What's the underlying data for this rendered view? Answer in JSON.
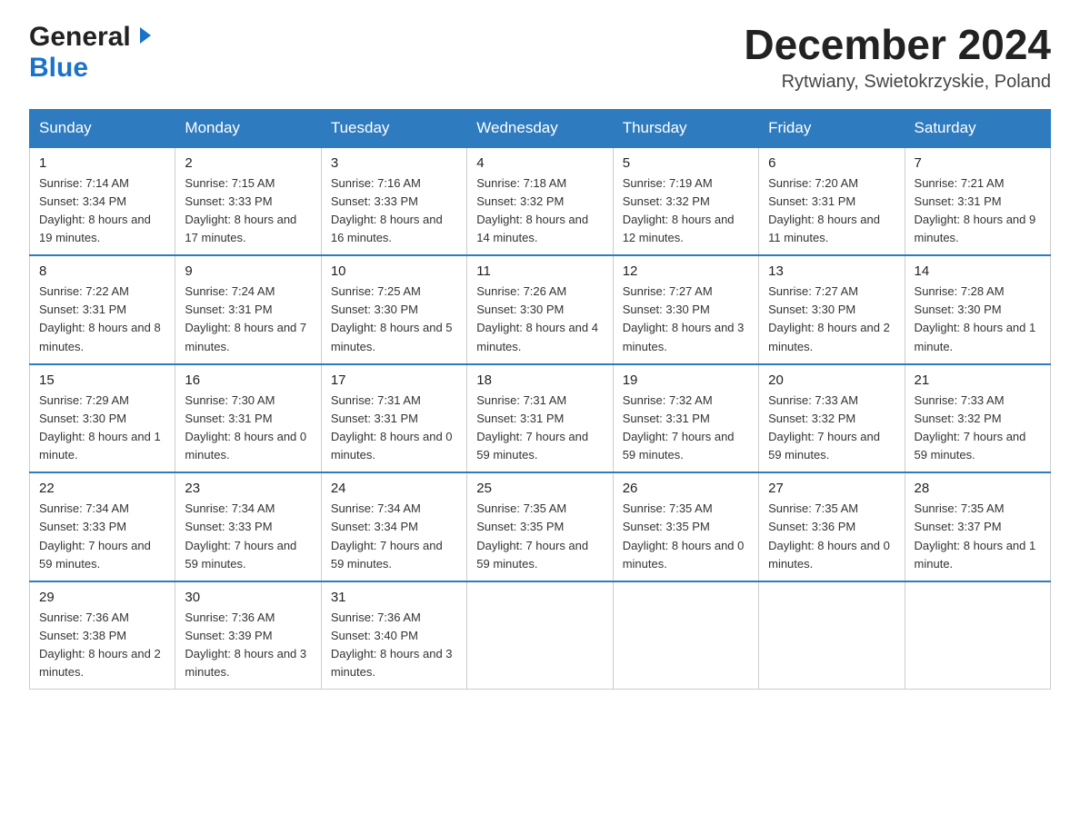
{
  "header": {
    "logo_general": "General",
    "logo_blue": "Blue",
    "month_title": "December 2024",
    "location": "Rytwiany, Swietokrzyskie, Poland"
  },
  "days_of_week": [
    "Sunday",
    "Monday",
    "Tuesday",
    "Wednesday",
    "Thursday",
    "Friday",
    "Saturday"
  ],
  "weeks": [
    [
      {
        "day": "1",
        "sunrise": "7:14 AM",
        "sunset": "3:34 PM",
        "daylight": "8 hours and 19 minutes."
      },
      {
        "day": "2",
        "sunrise": "7:15 AM",
        "sunset": "3:33 PM",
        "daylight": "8 hours and 17 minutes."
      },
      {
        "day": "3",
        "sunrise": "7:16 AM",
        "sunset": "3:33 PM",
        "daylight": "8 hours and 16 minutes."
      },
      {
        "day": "4",
        "sunrise": "7:18 AM",
        "sunset": "3:32 PM",
        "daylight": "8 hours and 14 minutes."
      },
      {
        "day": "5",
        "sunrise": "7:19 AM",
        "sunset": "3:32 PM",
        "daylight": "8 hours and 12 minutes."
      },
      {
        "day": "6",
        "sunrise": "7:20 AM",
        "sunset": "3:31 PM",
        "daylight": "8 hours and 11 minutes."
      },
      {
        "day": "7",
        "sunrise": "7:21 AM",
        "sunset": "3:31 PM",
        "daylight": "8 hours and 9 minutes."
      }
    ],
    [
      {
        "day": "8",
        "sunrise": "7:22 AM",
        "sunset": "3:31 PM",
        "daylight": "8 hours and 8 minutes."
      },
      {
        "day": "9",
        "sunrise": "7:24 AM",
        "sunset": "3:31 PM",
        "daylight": "8 hours and 7 minutes."
      },
      {
        "day": "10",
        "sunrise": "7:25 AM",
        "sunset": "3:30 PM",
        "daylight": "8 hours and 5 minutes."
      },
      {
        "day": "11",
        "sunrise": "7:26 AM",
        "sunset": "3:30 PM",
        "daylight": "8 hours and 4 minutes."
      },
      {
        "day": "12",
        "sunrise": "7:27 AM",
        "sunset": "3:30 PM",
        "daylight": "8 hours and 3 minutes."
      },
      {
        "day": "13",
        "sunrise": "7:27 AM",
        "sunset": "3:30 PM",
        "daylight": "8 hours and 2 minutes."
      },
      {
        "day": "14",
        "sunrise": "7:28 AM",
        "sunset": "3:30 PM",
        "daylight": "8 hours and 1 minute."
      }
    ],
    [
      {
        "day": "15",
        "sunrise": "7:29 AM",
        "sunset": "3:30 PM",
        "daylight": "8 hours and 1 minute."
      },
      {
        "day": "16",
        "sunrise": "7:30 AM",
        "sunset": "3:31 PM",
        "daylight": "8 hours and 0 minutes."
      },
      {
        "day": "17",
        "sunrise": "7:31 AM",
        "sunset": "3:31 PM",
        "daylight": "8 hours and 0 minutes."
      },
      {
        "day": "18",
        "sunrise": "7:31 AM",
        "sunset": "3:31 PM",
        "daylight": "7 hours and 59 minutes."
      },
      {
        "day": "19",
        "sunrise": "7:32 AM",
        "sunset": "3:31 PM",
        "daylight": "7 hours and 59 minutes."
      },
      {
        "day": "20",
        "sunrise": "7:33 AM",
        "sunset": "3:32 PM",
        "daylight": "7 hours and 59 minutes."
      },
      {
        "day": "21",
        "sunrise": "7:33 AM",
        "sunset": "3:32 PM",
        "daylight": "7 hours and 59 minutes."
      }
    ],
    [
      {
        "day": "22",
        "sunrise": "7:34 AM",
        "sunset": "3:33 PM",
        "daylight": "7 hours and 59 minutes."
      },
      {
        "day": "23",
        "sunrise": "7:34 AM",
        "sunset": "3:33 PM",
        "daylight": "7 hours and 59 minutes."
      },
      {
        "day": "24",
        "sunrise": "7:34 AM",
        "sunset": "3:34 PM",
        "daylight": "7 hours and 59 minutes."
      },
      {
        "day": "25",
        "sunrise": "7:35 AM",
        "sunset": "3:35 PM",
        "daylight": "7 hours and 59 minutes."
      },
      {
        "day": "26",
        "sunrise": "7:35 AM",
        "sunset": "3:35 PM",
        "daylight": "8 hours and 0 minutes."
      },
      {
        "day": "27",
        "sunrise": "7:35 AM",
        "sunset": "3:36 PM",
        "daylight": "8 hours and 0 minutes."
      },
      {
        "day": "28",
        "sunrise": "7:35 AM",
        "sunset": "3:37 PM",
        "daylight": "8 hours and 1 minute."
      }
    ],
    [
      {
        "day": "29",
        "sunrise": "7:36 AM",
        "sunset": "3:38 PM",
        "daylight": "8 hours and 2 minutes."
      },
      {
        "day": "30",
        "sunrise": "7:36 AM",
        "sunset": "3:39 PM",
        "daylight": "8 hours and 3 minutes."
      },
      {
        "day": "31",
        "sunrise": "7:36 AM",
        "sunset": "3:40 PM",
        "daylight": "8 hours and 3 minutes."
      },
      null,
      null,
      null,
      null
    ]
  ],
  "labels": {
    "sunrise": "Sunrise:",
    "sunset": "Sunset:",
    "daylight": "Daylight:"
  }
}
